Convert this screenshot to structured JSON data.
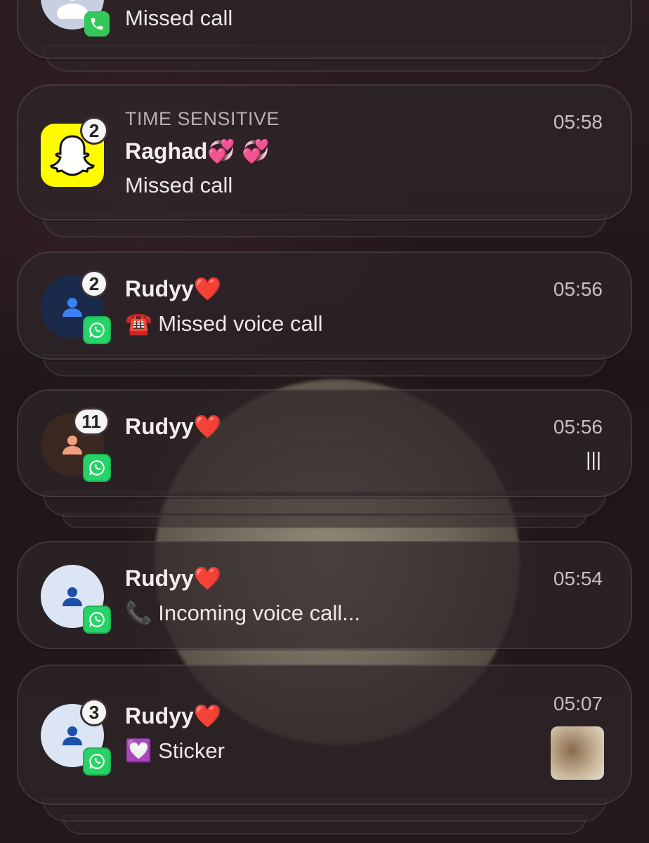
{
  "notifications": [
    {
      "id": "n0",
      "body": "Missed call"
    },
    {
      "id": "n1",
      "meta": "TIME SENSITIVE",
      "title": "Raghad💞 💞",
      "body": "Missed call",
      "time": "05:58",
      "count": "2",
      "app": "snapchat"
    },
    {
      "id": "n2",
      "title": "Rudyy",
      "body": "☎️ Missed voice call",
      "time": "05:56",
      "count": "2",
      "app": "whatsapp"
    },
    {
      "id": "n3",
      "title": "Rudyy",
      "body": "",
      "time": "05:56",
      "count": "11",
      "app": "whatsapp",
      "indicator": "|||"
    },
    {
      "id": "n4",
      "title": "Rudyy",
      "body": "📞 Incoming voice call...",
      "time": "05:54",
      "app": "whatsapp"
    },
    {
      "id": "n5",
      "title": "Rudyy",
      "body": "💟 Sticker",
      "time": "05:07",
      "count": "3",
      "app": "whatsapp"
    }
  ],
  "heart": "❤️",
  "colors": {
    "whatsapp": "#25d366",
    "snapchat": "#fffc00",
    "phone": "#34c759"
  }
}
